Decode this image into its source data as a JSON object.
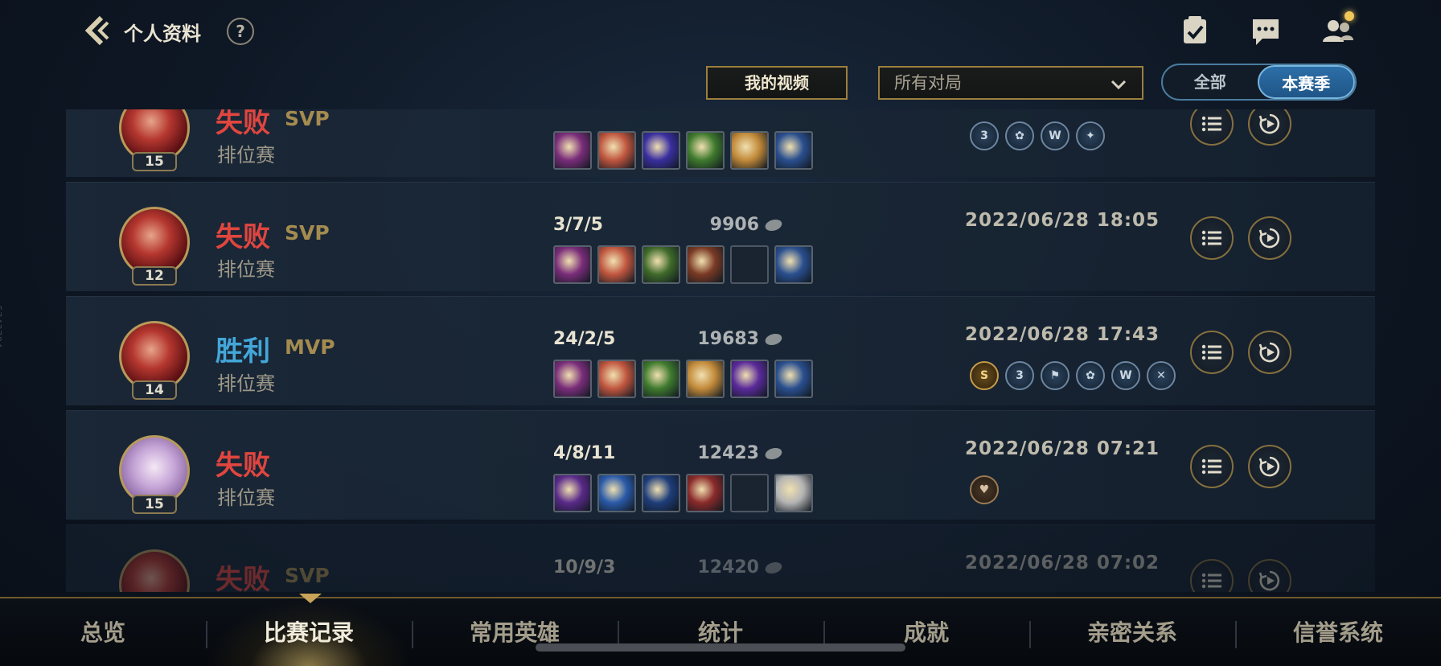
{
  "watermark_id": "5743784",
  "header": {
    "title": "个人资料",
    "help": "?"
  },
  "filters": {
    "video_button": "我的视频",
    "match_filter": "所有对局",
    "season_options": [
      "全部",
      "本赛季"
    ],
    "season_selected": "本赛季"
  },
  "matches": [
    {
      "result": "失败",
      "outcome": "loss",
      "badge": "SVP",
      "mode": "排位赛",
      "level": "15",
      "avatar": "red-hair-champion",
      "kda": "",
      "gold": "",
      "date": "",
      "items": [
        "#7a2d7a",
        "#c0563f",
        "#3a2fa0",
        "#3f7a2e",
        "#c28a3a",
        "#2a4f8f"
      ],
      "honors": [
        {
          "label": "3",
          "tone": "blue"
        },
        {
          "label": "✿",
          "tone": "blue"
        },
        {
          "label": "W",
          "tone": "blue"
        },
        {
          "label": "✦",
          "tone": "blue"
        }
      ]
    },
    {
      "result": "失败",
      "outcome": "loss",
      "badge": "SVP",
      "mode": "排位赛",
      "level": "12",
      "avatar": "red-hair-champion",
      "kda": "3/7/5",
      "gold": "9906",
      "date": "2022/06/28 18:05",
      "items": [
        "#7a2d7a",
        "#c0563f",
        "#3f6a2a",
        "#7a3a24",
        "",
        "#2a4f8f"
      ],
      "honors": []
    },
    {
      "result": "胜利",
      "outcome": "win",
      "badge": "MVP",
      "mode": "排位赛",
      "level": "14",
      "avatar": "red-hair-champion",
      "kda": "24/2/5",
      "gold": "19683",
      "date": "2022/06/28 17:43",
      "items": [
        "#7a2d7a",
        "#c0563f",
        "#3f7a2e",
        "#c28a3a",
        "#5a2a9a",
        "#2a4f8f"
      ],
      "honors": [
        {
          "label": "S",
          "tone": "gold"
        },
        {
          "label": "3",
          "tone": "blue"
        },
        {
          "label": "⚑",
          "tone": "blue"
        },
        {
          "label": "✿",
          "tone": "blue"
        },
        {
          "label": "W",
          "tone": "blue"
        },
        {
          "label": "✕",
          "tone": "blue"
        }
      ]
    },
    {
      "result": "失败",
      "outcome": "loss",
      "badge": "",
      "mode": "排位赛",
      "level": "15",
      "avatar": "lilac-champion",
      "kda": "4/8/11",
      "gold": "12423",
      "date": "2022/06/28 07:21",
      "items": [
        "#5a2a8a",
        "#2a5aa8",
        "#1e3d7a",
        "#8a2a2a",
        "",
        "#b4b4b4"
      ],
      "honors": [
        {
          "label": "♥",
          "tone": "bronze"
        }
      ]
    },
    {
      "result": "失败",
      "outcome": "loss",
      "badge": "SVP",
      "mode": "",
      "level": "",
      "avatar": "red-hair-champion",
      "kda": "10/9/3",
      "gold": "12420",
      "date": "2022/06/28 07:02",
      "items": [],
      "honors": []
    }
  ],
  "bottom_nav": {
    "tabs": [
      "总览",
      "比赛记录",
      "常用英雄",
      "统计",
      "成就",
      "亲密关系",
      "信誉系统"
    ],
    "active": "比赛记录"
  },
  "colors": {
    "loss": "#e0463f",
    "win": "#43a7d9",
    "gold_border": "#9c7f3e",
    "accent_blue": "#2d6fa8"
  }
}
